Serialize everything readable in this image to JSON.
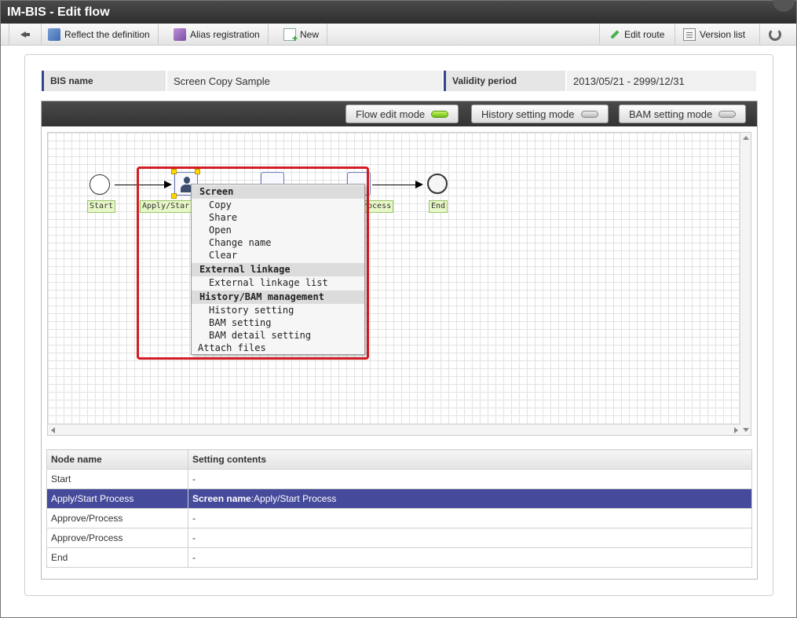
{
  "window": {
    "title": "IM-BIS - Edit flow"
  },
  "toolbar": {
    "back_label": "",
    "reflect_label": "Reflect the definition",
    "alias_label": "Alias registration",
    "new_label": "New",
    "edit_route_label": "Edit route",
    "version_list_label": "Version list"
  },
  "info": {
    "bis_name_label": "BIS name",
    "bis_name_value": "Screen Copy Sample",
    "validity_label": "Validity period",
    "validity_value": "2013/05/21 - 2999/12/31"
  },
  "modes": {
    "flow_edit": {
      "label": "Flow edit mode",
      "active": true
    },
    "history_setting": {
      "label": "History setting mode",
      "active": false
    },
    "bam_setting": {
      "label": "BAM setting mode",
      "active": false
    }
  },
  "flow": {
    "start_label": "Start",
    "apply_label": "Apply/Star",
    "approve_label": "rocess",
    "end_label": "End"
  },
  "context_menu": {
    "screen_header": "Screen",
    "screen_items": [
      "Copy",
      "Share",
      "Open",
      "Change name",
      "Clear"
    ],
    "external_header": "External linkage",
    "external_items": [
      "External linkage list"
    ],
    "history_header": "History/BAM management",
    "history_items": [
      "History setting",
      "BAM setting",
      "BAM detail setting"
    ],
    "attach_label": "Attach files"
  },
  "table": {
    "headers": [
      "Node name",
      "Setting contents"
    ],
    "rows": [
      {
        "name": "Start",
        "content_key": "",
        "content": "-"
      },
      {
        "name": "Apply/Start Process",
        "content_key": "Screen name",
        "content": ":Apply/Start Process"
      },
      {
        "name": "Approve/Process",
        "content_key": "",
        "content": "-"
      },
      {
        "name": "Approve/Process",
        "content_key": "",
        "content": "-"
      },
      {
        "name": "End",
        "content_key": "",
        "content": "-"
      }
    ]
  },
  "colors": {
    "accent": "#34458b",
    "selected_row": "#454a9b",
    "highlight": "#d31c24",
    "led_on": "#6cbd12"
  },
  "icons": [
    "back-arrow-icon",
    "reflect-icon",
    "alias-icon",
    "new-icon",
    "pencil-icon",
    "list-icon",
    "refresh-icon",
    "person-icon"
  ]
}
